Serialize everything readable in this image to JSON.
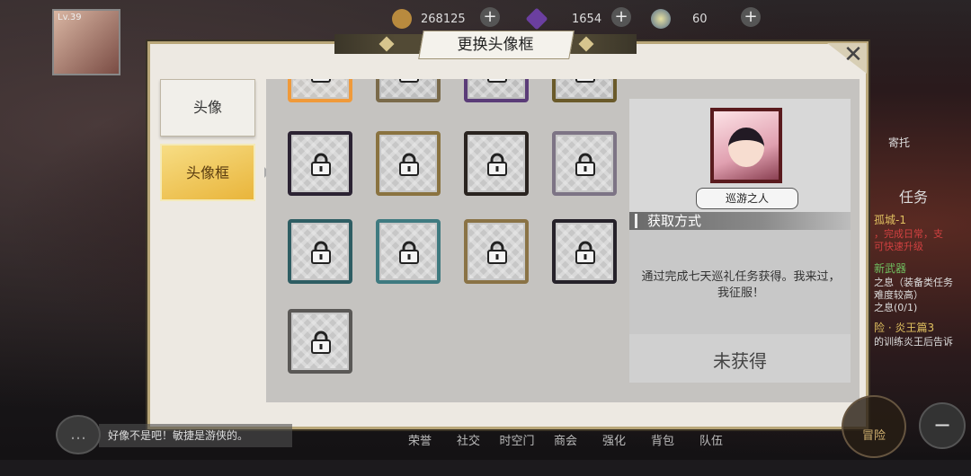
{
  "hud": {
    "level": "Lv.39",
    "gold": "268125",
    "crystal": "1654",
    "energy": "60",
    "plus_label": "+",
    "minus_label": "−"
  },
  "side_menu": {
    "item1": "寄托",
    "item2": "任务",
    "line1": "孤城-1",
    "line2": "，完成日常，支",
    "line3": "可快速升级",
    "line4": "新武器",
    "line5": "之息（装备类任务",
    "line6": "难度较高）",
    "line7": "之息(0/1)",
    "line8": "险 · 炎王篇3",
    "line9": "的训练炎王后告诉"
  },
  "bottom_nav": [
    "荣誉",
    "社交",
    "时空门",
    "商会",
    "强化",
    "背包",
    "队伍"
  ],
  "adventure_label": "冒险",
  "chat_text": "好像不是吧！敏捷是游侠的。",
  "dialog": {
    "title": "更换头像框",
    "close_label": "✕",
    "tabs": {
      "avatar": "头像",
      "frame": "头像框"
    },
    "selected": {
      "name": "巡游之人",
      "obtain_header": "获取方式",
      "obtain_desc": "通过完成七天巡礼任务获得。我来过，我征服！",
      "status": "未获得"
    }
  },
  "colors": {
    "accent_gold": "#e9b53b",
    "frame_border": "#b9a779",
    "dialog_bg": "#ede9e2"
  },
  "frames": [
    {
      "id": "frame-row0-a",
      "locked": true,
      "variant": "gold-orange",
      "partial": true
    },
    {
      "id": "frame-row0-b",
      "locked": true,
      "variant": "bronze",
      "partial": true
    },
    {
      "id": "frame-row0-c",
      "locked": true,
      "variant": "purple",
      "partial": true
    },
    {
      "id": "frame-row0-d",
      "locked": true,
      "variant": "gold-dark",
      "partial": true
    },
    {
      "id": "frame-1",
      "locked": true,
      "variant": "purple-dark"
    },
    {
      "id": "frame-2",
      "locked": true,
      "variant": "gold-teal"
    },
    {
      "id": "frame-3",
      "locked": true,
      "variant": "black-gold"
    },
    {
      "id": "frame-4",
      "locked": true,
      "variant": "silver-purple"
    },
    {
      "id": "frame-5",
      "locked": true,
      "variant": "teal-gold"
    },
    {
      "id": "frame-6",
      "locked": true,
      "variant": "teal-silver"
    },
    {
      "id": "frame-7",
      "locked": true,
      "variant": "bronze-gold"
    },
    {
      "id": "frame-8",
      "locked": true,
      "variant": "dark-ornate"
    },
    {
      "id": "frame-9",
      "locked": true,
      "variant": "stone-grey"
    }
  ]
}
